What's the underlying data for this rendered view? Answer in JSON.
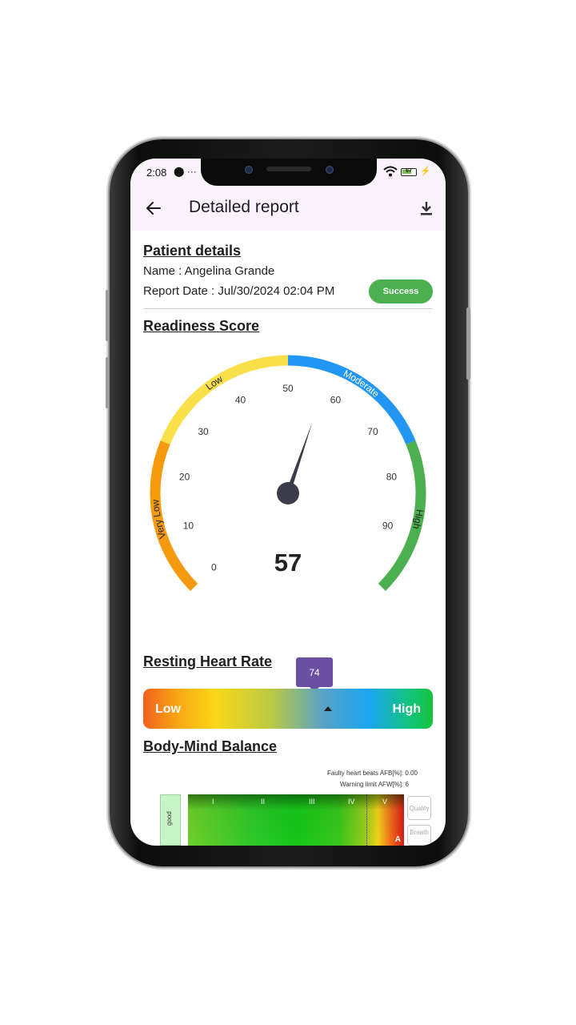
{
  "status_bar": {
    "time": "2:08",
    "left_icons": "⬤ ···",
    "battery_level": "67"
  },
  "app_bar": {
    "title": "Detailed report"
  },
  "patient": {
    "heading": "Patient details",
    "name_line": "Name : Angelina Grande",
    "date_line": "Report Date : Jul/30/2024 02:04 PM",
    "status_badge": "Success",
    "status_color": "#4caf50"
  },
  "readiness": {
    "heading": "Readiness Score",
    "value": 57,
    "value_text": "57",
    "min": 0,
    "max": 100,
    "ticks": [
      "0",
      "10",
      "20",
      "30",
      "40",
      "50",
      "60",
      "70",
      "80",
      "90"
    ],
    "bands": [
      {
        "label": "Very Low",
        "from": 0,
        "to": 25,
        "color": "#f59a0f"
      },
      {
        "label": "Low",
        "from": 25,
        "to": 50,
        "color": "#f9e04b"
      },
      {
        "label": "Moderate",
        "from": 50,
        "to": 75,
        "color": "#2196f3"
      },
      {
        "label": "High",
        "from": 75,
        "to": 100,
        "color": "#4caf50"
      }
    ]
  },
  "resting_heart_rate": {
    "heading": "Resting Heart Rate",
    "value": "74",
    "low_label": "Low",
    "high_label": "High"
  },
  "body_mind": {
    "heading": "Body-Mind Balance",
    "afb_line": "Faulty heart beats AFB[%]:  0.00",
    "afw_line": "Warning limit AFW[%]:  6",
    "side_label": "good",
    "roman": [
      "I",
      "II",
      "III",
      "IV",
      "V"
    ],
    "corner_label": "A",
    "buttons": [
      "Quality",
      "Breath"
    ]
  }
}
